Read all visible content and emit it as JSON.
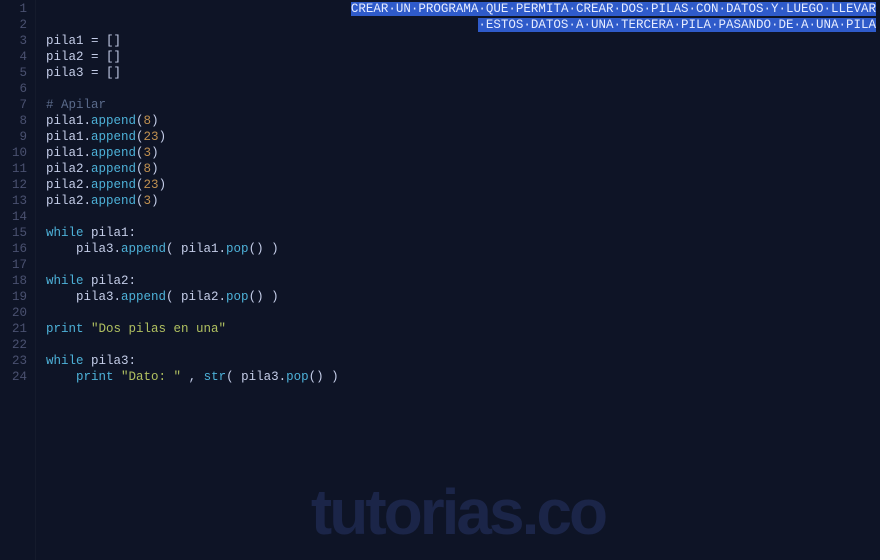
{
  "watermark": "tutorias.co",
  "gutter": [
    "1",
    "2",
    "3",
    "4",
    "5",
    "6",
    "7",
    "8",
    "9",
    "10",
    "11",
    "12",
    "13",
    "14",
    "15",
    "16",
    "17",
    "18",
    "19",
    "20",
    "21",
    "22",
    "23",
    "24"
  ],
  "selection_line1": "CREAR·UN·PROGRAMA·QUE·PERMITA·CREAR·DOS·PILAS·CON·DATOS·Y·LUEGO·LLEVAR",
  "selection_line2": "·ESTOS·DATOS·A·UNA·TERCERA·PILA·PASANDO·DE·A·UNA·PILA",
  "code": {
    "l3_a": "pila1 ",
    "l3_b": "=",
    "l3_c": " []",
    "l4_a": "pila2 ",
    "l4_b": "=",
    "l4_c": " []",
    "l5_a": "pila3 ",
    "l5_b": "=",
    "l5_c": " []",
    "l7": "# Apilar",
    "l8_a": "pila1.",
    "l8_b": "append",
    "l8_c": "(",
    "l8_d": "8",
    "l8_e": ")",
    "l9_a": "pila1.",
    "l9_b": "append",
    "l9_c": "(",
    "l9_d": "23",
    "l9_e": ")",
    "l10_a": "pila1.",
    "l10_b": "append",
    "l10_c": "(",
    "l10_d": "3",
    "l10_e": ")",
    "l11_a": "pila2.",
    "l11_b": "append",
    "l11_c": "(",
    "l11_d": "8",
    "l11_e": ")",
    "l12_a": "pila2.",
    "l12_b": "append",
    "l12_c": "(",
    "l12_d": "23",
    "l12_e": ")",
    "l13_a": "pila2.",
    "l13_b": "append",
    "l13_c": "(",
    "l13_d": "3",
    "l13_e": ")",
    "l15_a": "while",
    "l15_b": " pila1:",
    "l16_a": "    pila3.",
    "l16_b": "append",
    "l16_c": "( pila1.",
    "l16_d": "pop",
    "l16_e": "() )",
    "l18_a": "while",
    "l18_b": " pila2:",
    "l19_a": "    pila3.",
    "l19_b": "append",
    "l19_c": "( pila2.",
    "l19_d": "pop",
    "l19_e": "() )",
    "l21_a": "print",
    "l21_b": " ",
    "l21_c": "\"Dos pilas en una\"",
    "l23_a": "while",
    "l23_b": " pila3:",
    "l24_a": "    ",
    "l24_b": "print",
    "l24_c": " ",
    "l24_d": "\"Dato: \"",
    "l24_e": " , ",
    "l24_f": "str",
    "l24_g": "( pila3.",
    "l24_h": "pop",
    "l24_i": "() )"
  }
}
